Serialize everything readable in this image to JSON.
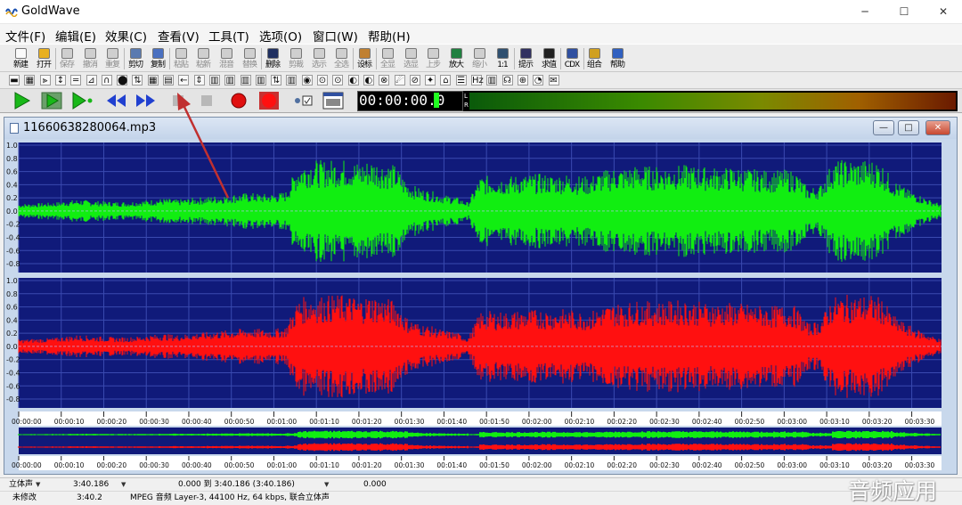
{
  "app": {
    "title": "GoldWave"
  },
  "menu": [
    "文件(F)",
    "编辑(E)",
    "效果(C)",
    "查看(V)",
    "工具(T)",
    "选项(O)",
    "窗口(W)",
    "帮助(H)"
  ],
  "toolbar": [
    {
      "label": "新建",
      "color": "#fafafa",
      "enabled": true
    },
    {
      "label": "打开",
      "color": "#e8b020",
      "enabled": true
    },
    {
      "label": "保存",
      "color": "#cfcfcf",
      "enabled": false
    },
    {
      "label": "撤消",
      "color": "#cfcfcf",
      "enabled": false
    },
    {
      "label": "重复",
      "color": "#cfcfcf",
      "enabled": false
    },
    {
      "label": "剪切",
      "color": "#5a7ab0",
      "enabled": true
    },
    {
      "label": "复制",
      "color": "#4a70c0",
      "enabled": true
    },
    {
      "label": "粘贴",
      "color": "#cfcfcf",
      "enabled": false
    },
    {
      "label": "粘新",
      "color": "#cfcfcf",
      "enabled": false
    },
    {
      "label": "混音",
      "color": "#cfcfcf",
      "enabled": false
    },
    {
      "label": "替换",
      "color": "#cfcfcf",
      "enabled": false
    },
    {
      "label": "删除",
      "color": "#203060",
      "enabled": true
    },
    {
      "label": "剪裁",
      "color": "#cfcfcf",
      "enabled": false
    },
    {
      "label": "选示",
      "color": "#cfcfcf",
      "enabled": false
    },
    {
      "label": "全选",
      "color": "#cfcfcf",
      "enabled": false
    },
    {
      "label": "设标",
      "color": "#c08030",
      "enabled": true
    },
    {
      "label": "全显",
      "color": "#cfcfcf",
      "enabled": false
    },
    {
      "label": "选显",
      "color": "#cfcfcf",
      "enabled": false
    },
    {
      "label": "上步",
      "color": "#cfcfcf",
      "enabled": false
    },
    {
      "label": "放大",
      "color": "#208040",
      "enabled": true
    },
    {
      "label": "缩小",
      "color": "#cfcfcf",
      "enabled": false
    },
    {
      "label": "1:1",
      "color": "#305070",
      "enabled": true
    },
    {
      "label": "提示",
      "color": "#303060",
      "enabled": true
    },
    {
      "label": "求值",
      "color": "#202020",
      "enabled": true
    },
    {
      "label": "CDX",
      "color": "#3050a0",
      "enabled": true
    },
    {
      "label": "组合",
      "color": "#d0a020",
      "enabled": true
    },
    {
      "label": "帮助",
      "color": "#3060c0",
      "enabled": true
    }
  ],
  "transport": {
    "time": "00:00:00.0",
    "meter_left": "L",
    "meter_right": "R"
  },
  "document": {
    "filename": "11660638280064.mp3",
    "min_icon": "—",
    "max_icon": "□",
    "close_icon": "✕"
  },
  "waveform": {
    "y_ticks": [
      "1.0",
      "0.8",
      "0.6",
      "0.4",
      "0.2",
      "0.0",
      "-0.2",
      "-0.4",
      "-0.6",
      "-0.8"
    ],
    "time_ticks": [
      "00:00:00",
      "00:00:10",
      "00:00:20",
      "00:00:30",
      "00:00:40",
      "00:00:50",
      "00:01:00",
      "00:01:10",
      "00:01:20",
      "00:01:30",
      "00:01:40",
      "00:01:50",
      "00:02:00",
      "00:02:10",
      "00:02:20",
      "00:02:30",
      "00:02:40",
      "00:02:50",
      "00:03:00",
      "00:03:10",
      "00:03:20",
      "00:03:30"
    ],
    "left_color": "#11ee11",
    "right_color": "#ff1010",
    "bg_color": "#101a7a",
    "envelope": [
      0.12,
      0.13,
      0.14,
      0.15,
      0.18,
      0.2,
      0.18,
      0.17,
      0.16,
      0.16,
      0.18,
      0.2,
      0.22,
      0.2,
      0.22,
      0.24,
      0.26,
      0.28,
      0.3,
      0.32,
      0.3,
      0.3,
      0.34,
      0.82,
      0.9,
      0.88,
      0.9,
      0.9,
      0.85,
      0.9,
      0.85,
      0.8,
      0.5,
      0.4,
      0.35,
      0.28,
      0.25,
      0.15,
      0.6,
      0.62,
      0.6,
      0.62,
      0.64,
      0.65,
      0.63,
      0.65,
      0.62,
      0.6,
      0.7,
      0.75,
      0.76,
      0.8,
      0.78,
      0.78,
      0.8,
      0.8,
      0.78,
      0.76,
      0.76,
      0.76,
      0.74,
      0.72,
      0.7,
      0.72,
      0.7,
      0.4,
      0.45,
      0.85,
      0.9,
      0.88,
      0.9,
      0.86,
      0.55,
      0.4,
      0.3,
      0.2,
      0.12
    ]
  },
  "status": {
    "channel": "立体声",
    "length": "3:40.186",
    "range": "0.000 到 3:40.186 (3:40.186)",
    "position": "0.000",
    "modified": "未修改",
    "duration": "3:40.2",
    "format": "MPEG 音频 Layer-3, 44100 Hz, 64 kbps, 联合立体声"
  },
  "watermark": "音频应用"
}
